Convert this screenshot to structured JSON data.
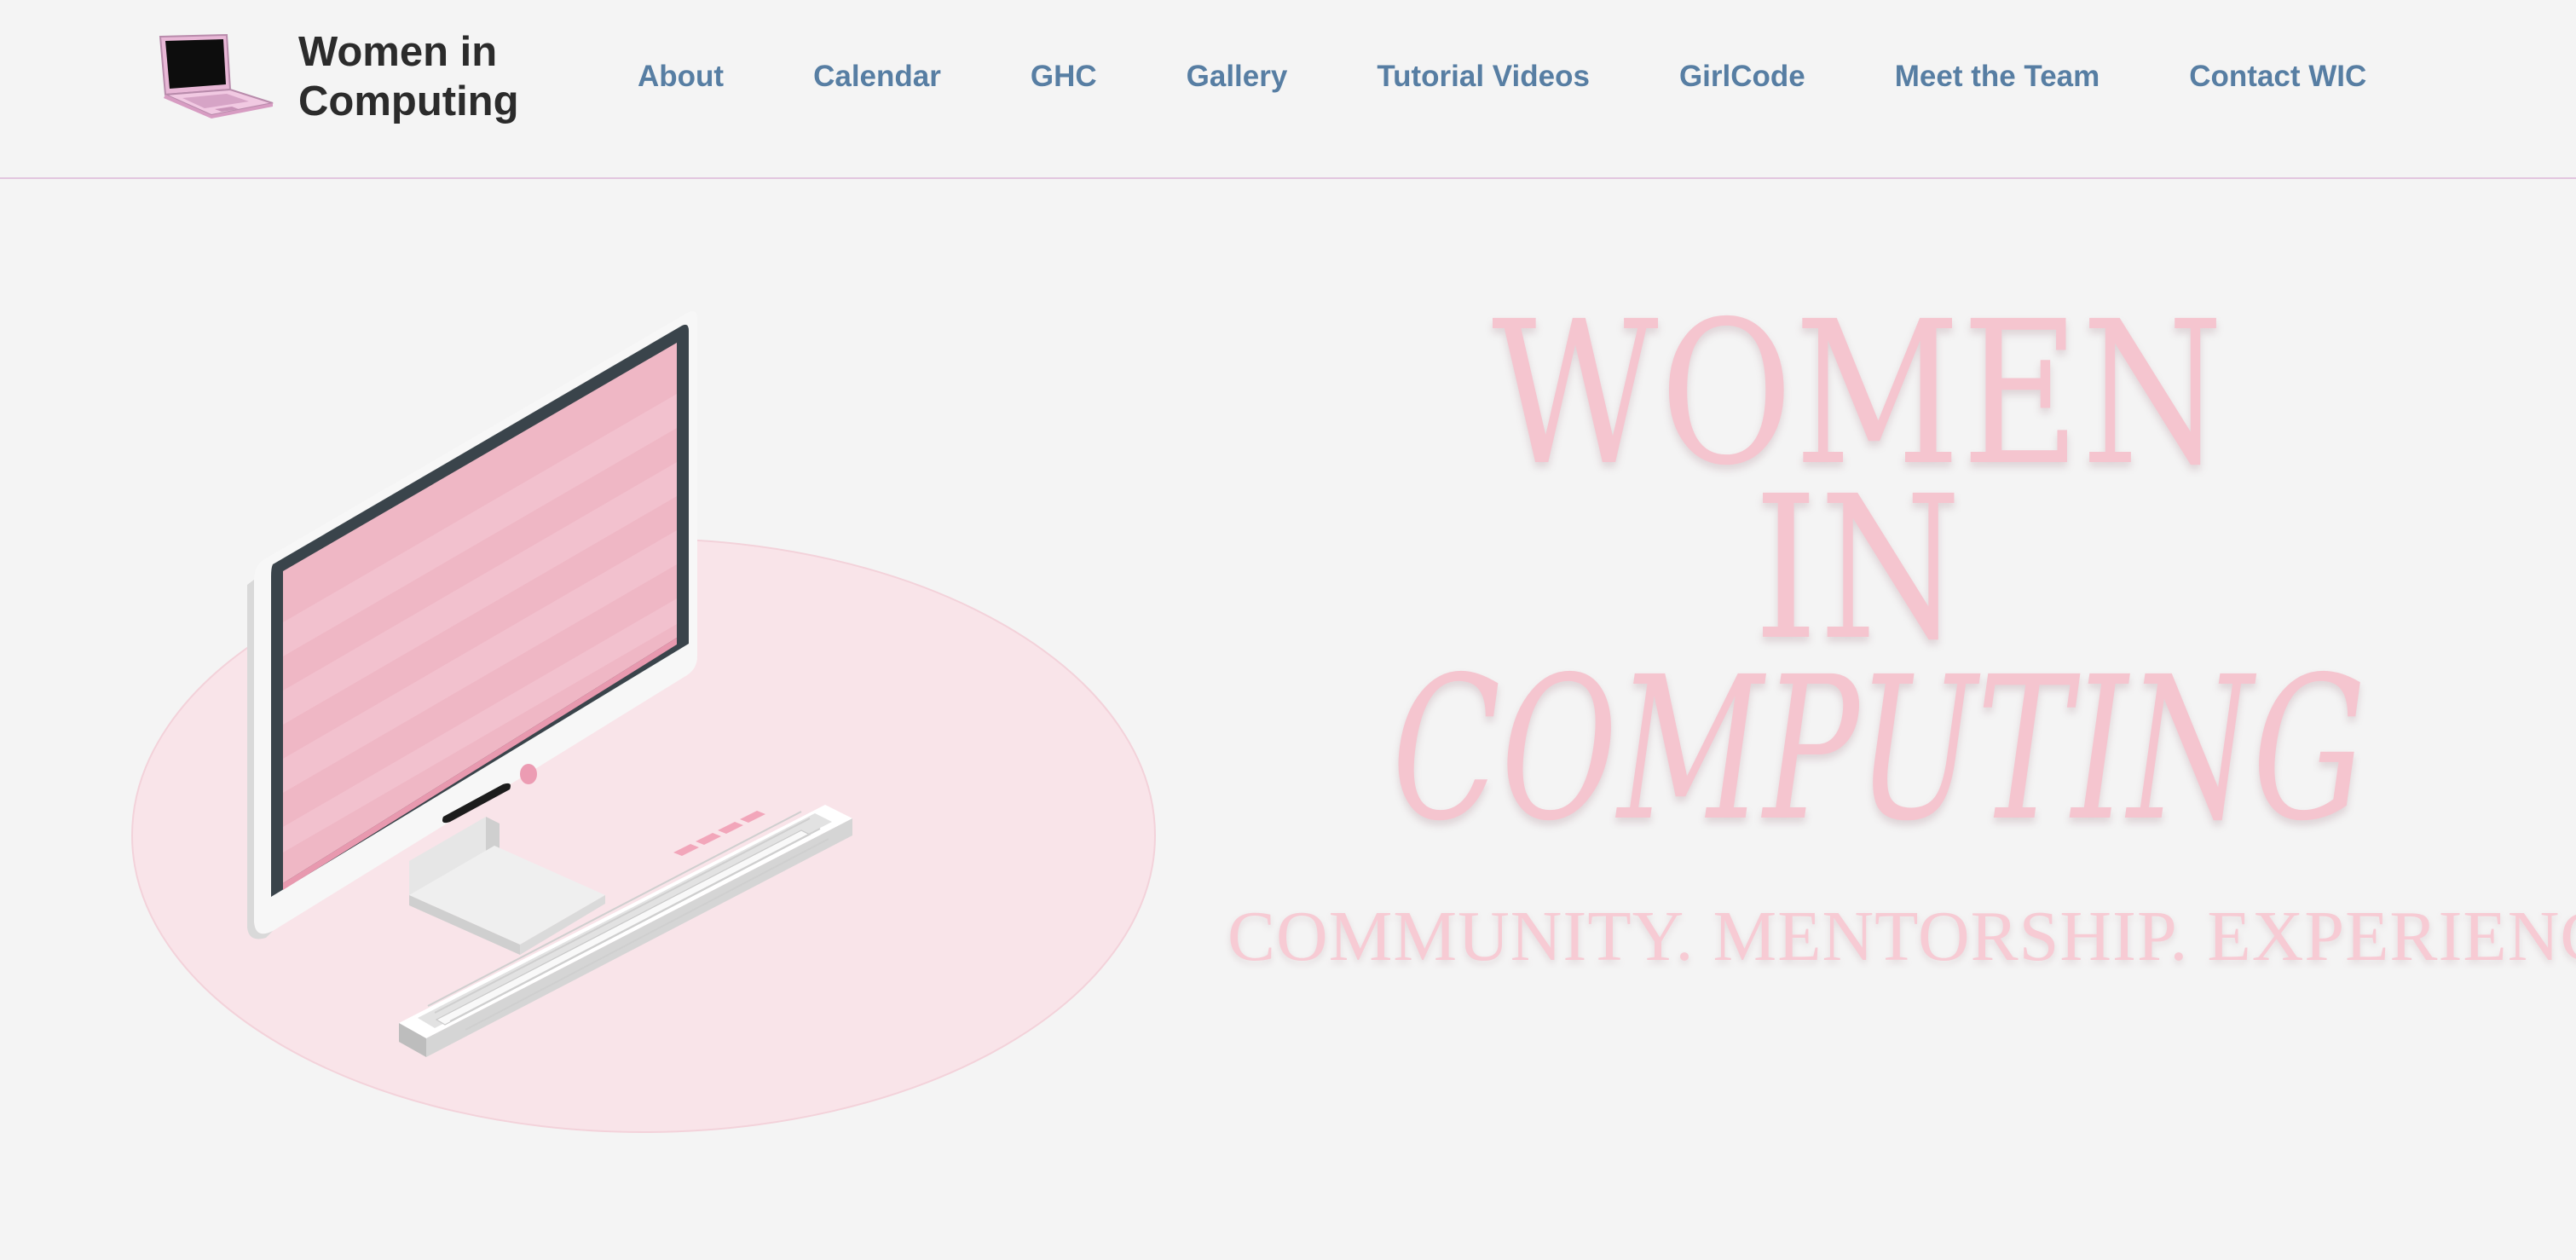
{
  "site": {
    "title_line1": "Women in",
    "title_line2": "Computing",
    "logo_icon": "pink-laptop-icon"
  },
  "nav": {
    "items": [
      {
        "label": "About"
      },
      {
        "label": "Calendar"
      },
      {
        "label": "GHC"
      },
      {
        "label": "Gallery"
      },
      {
        "label": "Tutorial Videos"
      },
      {
        "label": "GirlCode"
      },
      {
        "label": "Meet the Team"
      },
      {
        "label": "Contact WIC"
      }
    ]
  },
  "hero": {
    "title_line1": "WOMEN",
    "title_line2": "IN",
    "title_line3": "COMPUTING",
    "tagline": "COMMUNITY. MENTORSHIP. EXPERIENCE",
    "illustration_icon": "desktop-computer-icon"
  },
  "colors": {
    "background": "#f4f4f4",
    "nav_link": "#577ea3",
    "brand_text": "#2b2b2b",
    "hero_pink": "#f5c5cf",
    "header_border": "#e2c6df"
  }
}
